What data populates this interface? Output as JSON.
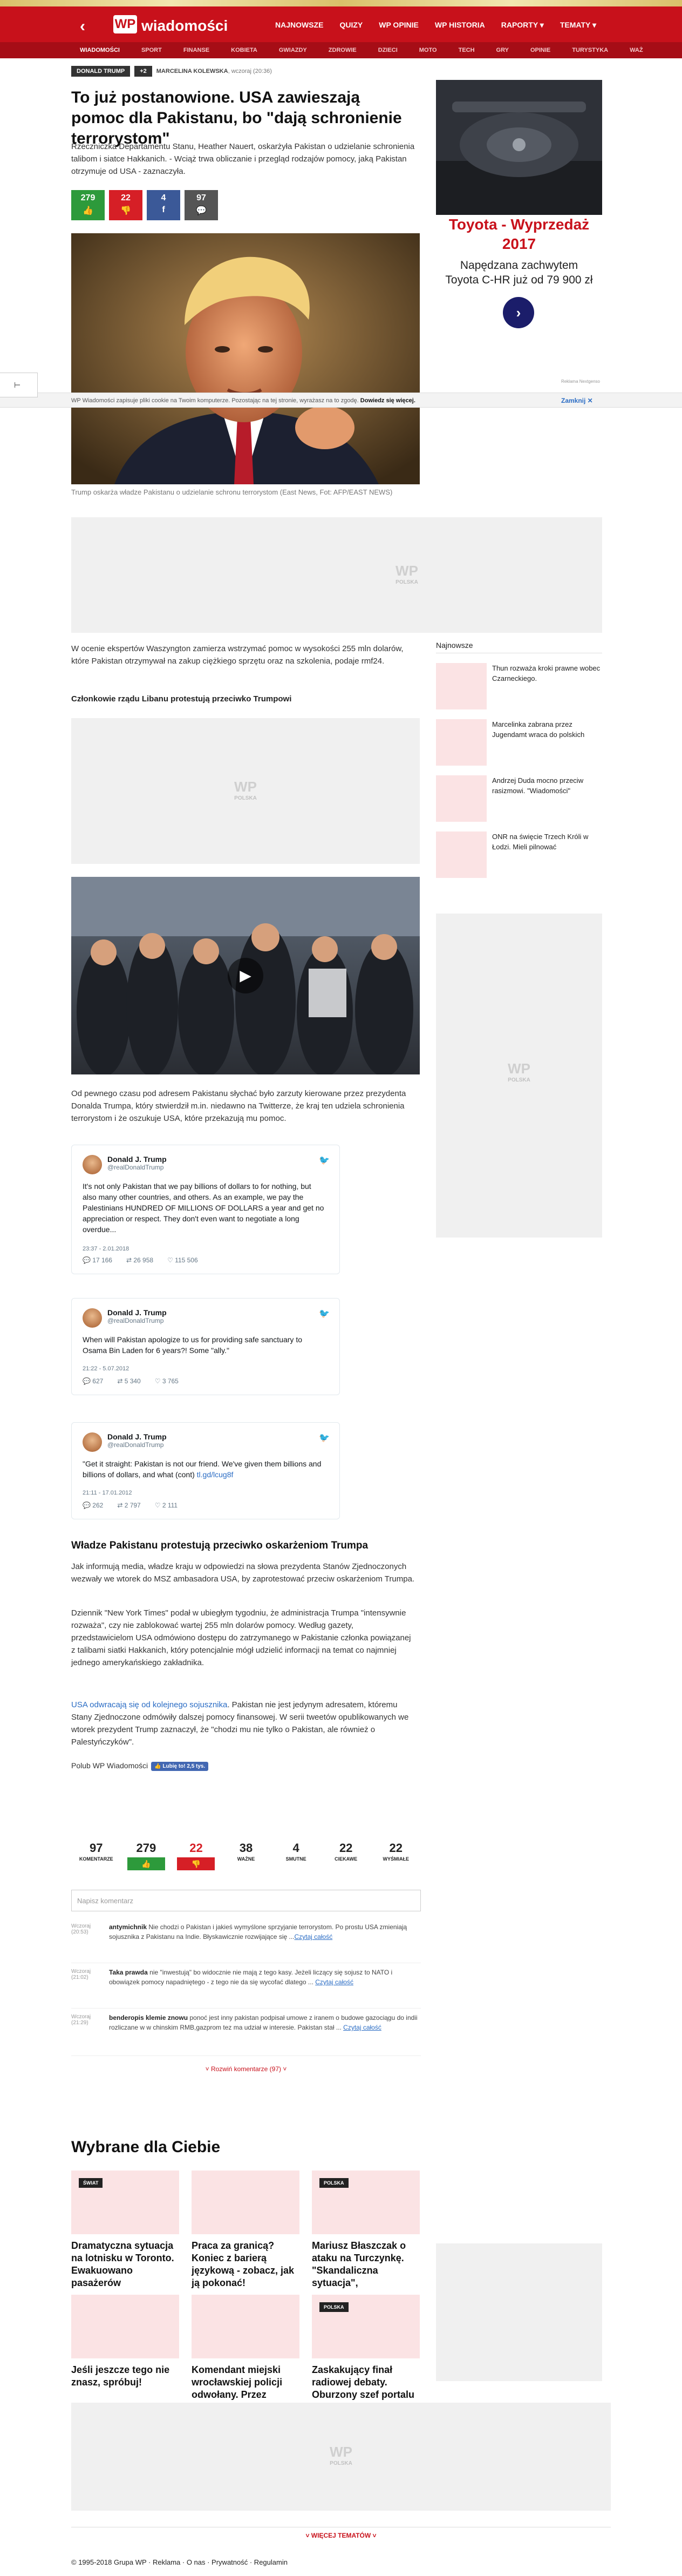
{
  "header": {
    "logo_letters": "WP",
    "logo_text": "wiadomości",
    "back_icon": "arrow-left-icon",
    "top_nav": [
      "NAJNOWSZE",
      "QUIZY",
      "WP OPINIE",
      "WP HISTORIA",
      "RAPORTY ▾",
      "TEMATY ▾"
    ],
    "sub_nav": [
      "WIADOMOŚCI",
      "SPORT",
      "FINANSE",
      "KOBIETA",
      "GWIAZDY",
      "ZDROWIE",
      "DZIECI",
      "MOTO",
      "TECH",
      "GRY",
      "OPINIE",
      "TURYSTYKA",
      "WAŻ"
    ]
  },
  "article": {
    "tag": "DONALD TRUMP",
    "tag_more": "+2",
    "author": "MARCELINA KOLEWSKA",
    "date": ", wczoraj (20:36)",
    "title": "To już postanowione. USA zawieszają pomoc dla Pakistanu, bo \"dają schronienie terrorystom\"",
    "lead": "Rzeczniczka Departamentu Stanu, Heather Nauert, oskarżyła Pakistan o udzielanie schronienia talibom i siatce Hakkanich. - Wciąż trwa obliczanie i przegląd rodzajów pomocy, jaką Pakistan otrzymuje od USA - zaznaczyła.",
    "votes": [
      {
        "count": "279",
        "icon": "thumb-up-icon",
        "color": "#2d9a3b"
      },
      {
        "count": "22",
        "icon": "thumb-down-icon",
        "color": "#d61f26"
      },
      {
        "count": "4",
        "icon": "facebook-icon",
        "color": "#3b5998"
      },
      {
        "count": "97",
        "icon": "comment-icon",
        "color": "#555555"
      }
    ],
    "photo1_caption": "Trump oskarża władze Pakistanu o udzielanie schronu terrorystom (East News, Fot: AFP/EAST NEWS)",
    "para1": "W ocenie ekspertów Waszyngton zamierza wstrzymać pomoc w wysokości 255 mln dolarów, które Pakistan otrzymywał na zakup ciężkiego sprzętu oraz na szkolenia, podaje rmf24.",
    "subhead1": "Członkowie rządu Libanu protestują przeciwko Trumpowi",
    "para2": "Od pewnego czasu pod adresem Pakistanu słychać było zarzuty kierowane przez prezydenta Donalda Trumpa, który stwierdził m.in. niedawno na Twitterze, że kraj ten udziela schronienia terrorystom i że oszukuje USA, które przekazują mu pomoc.",
    "subhead2": "Władze Pakistanu protestują przeciwko oskarżeniom Trumpa",
    "para3": "Jak informują media, władze kraju w odpowiedzi na słowa prezydenta Stanów Zjednoczonych wezwały we wtorek do MSZ ambasadora USA, by zaprotestować przeciw oskarżeniom Trumpa.",
    "para4": "Dziennik \"New York Times\" podał w ubiegłym tygodniu, że administracja Trumpa \"intensywnie rozważa\", czy nie zablokować wartej 255 mln dolarów pomocy. Według gazety, przedstawicielom USA odmówiono dostępu do zatrzymanego w Pakistanie członka powiązanej z talibami siatki Hakkanich, który potencjalnie mógł udzielić informacji na temat co najmniej jednego amerykańskiego zakładnika.",
    "para5_link": "USA odwracają się od kolejnego sojusznika",
    "para5": ". Pakistan nie jest jedynym adresatem, któremu Stany Zjednoczone odmówiły dalszej pomocy finansowej. W serii tweetów opublikowanych we wtorek prezydent Trump zaznaczył, że \"chodzi mu nie tylko o Pakistan, ale również o Palestyńczyków\".",
    "like_text": "Polub WP Wiadomości",
    "like_button": "👍 Lubię to! 2,5 tys."
  },
  "tweets": [
    {
      "name": "Donald J. Trump",
      "handle": "@realDonaldTrump",
      "text": "It's not only Pakistan that we pay billions of dollars to for nothing, but also many other countries, and others. As an example, we pay the Palestinians HUNDRED OF MILLIONS OF DOLLARS a year and get no appreciation or respect. They don't even want to negotiate a long overdue...",
      "time": "23:37 - 2.01.2018",
      "replies": "17 166",
      "retweets": "26 958",
      "likes": "115 506"
    },
    {
      "name": "Donald J. Trump",
      "handle": "@realDonaldTrump",
      "text": "When will Pakistan apologize to us for providing safe sanctuary to Osama Bin Laden for 6 years?! Some \"ally.\"",
      "time": "21:22 - 5.07.2012",
      "replies": "627",
      "retweets": "5 340",
      "likes": "3 765"
    },
    {
      "name": "Donald J. Trump",
      "handle": "@realDonaldTrump",
      "text": "\"Get it straight: Pakistan is not our friend. We've given them billions and billions of dollars, and what (cont) ",
      "link": "tl.gd/lcug8f",
      "time": "21:11 - 17.01.2012",
      "replies": "262",
      "retweets": "2 797",
      "likes": "2 111"
    }
  ],
  "sidebar": {
    "ad_label": "REKLAMA",
    "ad_title": "Toyota - Wyprzedaż 2017",
    "ad_text": "Napędzana zachwytem Toyota C-HR już od 79 900 zł",
    "ad_footer": "Reklama Nextgenso",
    "ad_top_tag": "OPINIE",
    "latest_header": "Najnowsze",
    "latest": [
      "Thun rozważa kroki prawne wobec Czarneckiego.",
      "Marcelinka zabrana przez Jugendamt wraca do polskich",
      "Andrzej Duda mocno przeciw rasizmowi. \"Wiadomości\"",
      "ONR na święcie Trzech Króli w Łodzi. Mieli pilnować"
    ]
  },
  "ad_placeholder": {
    "logo": "WP",
    "label": "POLSKA"
  },
  "cookie": {
    "text": "WP Wiadomości zapisuje pliki cookie na Twoim komputerze. Pozostając na tej stronie, wyrażasz na to zgodę. ",
    "text_bold": "Dowiedz się więcej.",
    "close": "Zamknij ✕"
  },
  "side_float": "⊢",
  "stats": [
    {
      "n": "97",
      "l": "KOMENTARZE"
    },
    {
      "n": "279",
      "l": "👍",
      "style": "green"
    },
    {
      "n": "22",
      "l": "👎",
      "style": "red"
    },
    {
      "n": "38",
      "l": "WAŻNE"
    },
    {
      "n": "4",
      "l": "SMUTNE"
    },
    {
      "n": "22",
      "l": "CIEKAWE"
    },
    {
      "n": "22",
      "l": "WYŚMIAŁE"
    }
  ],
  "comment_placeholder": "Napisz komentarz",
  "comments": [
    {
      "meta": "Wczoraj (20:53)",
      "author": "antymichnik",
      "text": " Nie chodzi o Pakistan i jakieś wymyślone sprzyjanie terrorystom. Po prostu USA zmieniają sojusznika z Pakistanu na Indie. Błyskawicznie rozwijające się ...",
      "more": "Czytaj całość"
    },
    {
      "meta": "Wczoraj (21:02)",
      "author": "Taka prawda",
      "text": " nie \"inwestują\" bo widocznie nie mają z tego kasy. Jeżeli liczący się sojusz to NATO i obowiązek pomocy napadniętego - z tego nie da się wycofać dlatego ... ",
      "more": "Czytaj całość"
    },
    {
      "meta": "Wczoraj (21:29)",
      "author": "benderopis klemie znowu",
      "text": " ponoć jest inny pakistan podpisał umowe z iranem o budowe gazociągu do indii rozliczane w w chinskim RMB,gazprom tez ma udział w interesie. Pakistan stał ... ",
      "more": "Czytaj całość"
    }
  ],
  "more_comments": "˅ Rozwiń komentarze (97) ˅",
  "recommended": {
    "title": "Wybrane dla Ciebie",
    "cards": [
      {
        "badge": "ŚWIAT",
        "title": "Dramatyczna sytuacja na lotnisku w Toronto. Ewakuowano pasażerów"
      },
      {
        "badge": "",
        "title": "Praca za granicą? Koniec z barierą językową - zobacz, jak ją pokonać!"
      },
      {
        "badge": "POLSKA",
        "title": "Mariusz Błaszczak o ataku na Turczynkę. \"Skandaliczna sytuacja\","
      },
      {
        "badge": "",
        "title": "Jeśli jeszcze tego nie znasz, spróbuj!"
      },
      {
        "badge": "",
        "title": "Komendant miejski wrocławskiej policji odwołany. Przez"
      },
      {
        "badge": "POLSKA",
        "title": "Zaskakujący finał radiowej debaty. Oburzony szef portalu"
      }
    ]
  },
  "more_topics": "˅ WIĘCEJ TEMATÓW ˅",
  "footer": "© 1995-2018 Grupa WP  ·  Reklama  ·  O nas  ·  Prywatność  ·  Regulamin"
}
